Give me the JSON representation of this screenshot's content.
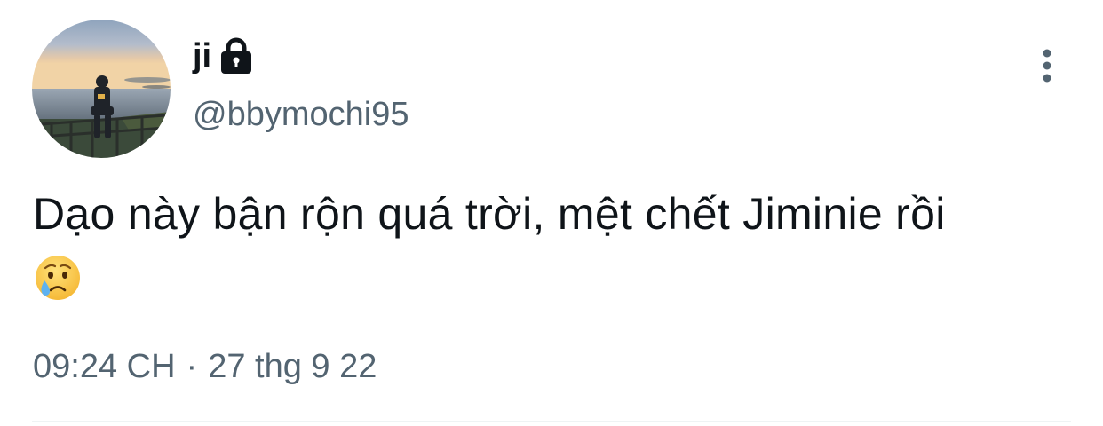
{
  "author": {
    "display_name": "ji",
    "handle": "@bbymochi95",
    "protected_icon": "lock-icon"
  },
  "tweet": {
    "text": "Dạo này bận rộn quá trời, mệt chết Jiminie rồi",
    "emoji": "😢",
    "emoji_icon": "crying-face-emoji"
  },
  "meta": {
    "time": "09:24 CH",
    "separator": "·",
    "date": "27 thg 9 22"
  },
  "actions": {
    "more_icon": "more-options-icon"
  },
  "colors": {
    "primary_text": "#0f1419",
    "secondary_text": "#536471",
    "divider": "#eff3f4"
  }
}
